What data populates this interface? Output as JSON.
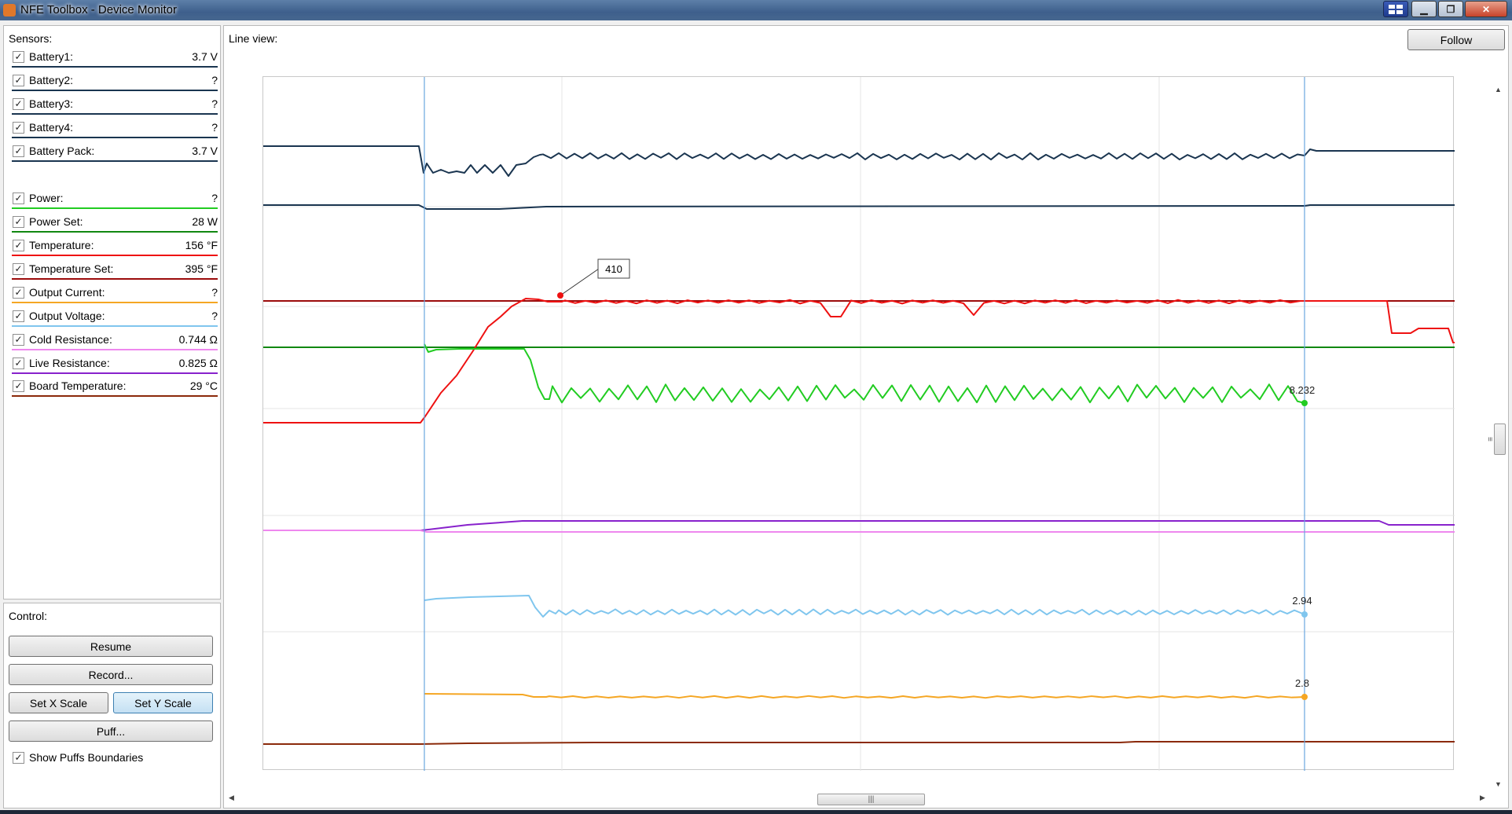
{
  "window": {
    "title": "NFE Toolbox - Device Monitor"
  },
  "sensors": {
    "header": "Sensors:",
    "items": [
      {
        "label": "Battery1:",
        "value": "3.7 V",
        "color": "#1a3550",
        "checked": "✓"
      },
      {
        "label": "Battery2:",
        "value": "?",
        "color": "#1a3550",
        "checked": "✓"
      },
      {
        "label": "Battery3:",
        "value": "?",
        "color": "#1a3550",
        "checked": "✓"
      },
      {
        "label": "Battery4:",
        "value": "?",
        "color": "#1a3550",
        "checked": "✓"
      },
      {
        "label": "Battery Pack:",
        "value": "3.7 V",
        "color": "#1a3550",
        "checked": "✓"
      },
      {
        "label": "Power:",
        "value": "?",
        "color": "#22cc22",
        "checked": "✓"
      },
      {
        "label": "Power Set:",
        "value": "28 W",
        "color": "#118811",
        "checked": "✓"
      },
      {
        "label": "Temperature:",
        "value": "156 °F",
        "color": "#ee1111",
        "checked": "✓"
      },
      {
        "label": "Temperature Set:",
        "value": "395 °F",
        "color": "#9b0b0b",
        "checked": "✓"
      },
      {
        "label": "Output Current:",
        "value": "?",
        "color": "#f5a623",
        "checked": "✓"
      },
      {
        "label": "Output Voltage:",
        "value": "?",
        "color": "#80c6ee",
        "checked": "✓"
      },
      {
        "label": "Cold Resistance:",
        "value": "0.744 Ω",
        "color": "#ee88ee",
        "checked": "✓"
      },
      {
        "label": "Live Resistance:",
        "value": "0.825 Ω",
        "color": "#8822cc",
        "checked": "✓"
      },
      {
        "label": "Board Temperature:",
        "value": "29 °C",
        "color": "#8b2a0a",
        "checked": "✓"
      }
    ]
  },
  "control": {
    "header": "Control:",
    "resume_label": "Resume",
    "record_label": "Record...",
    "set_x_scale_label": "Set X Scale",
    "set_y_scale_label": "Set Y Scale",
    "puff_label": "Puff...",
    "show_puffs_boundaries": {
      "label": "Show Puffs Boundaries",
      "checked": "✓"
    }
  },
  "line_view": {
    "header": "Line view:",
    "follow_label": "Follow",
    "scroll_grip": "|||",
    "icons": {
      "minimize": "minimize-icon",
      "maximize": "maximize-icon",
      "close": "close-icon",
      "scroll_left": "arrow-left-icon",
      "scroll_right": "arrow-right-icon",
      "scroll_up": "arrow-up-icon",
      "scroll_down": "arrow-down-icon",
      "app": "app-icon",
      "layout": "layout-icon"
    }
  },
  "chart_data": {
    "type": "line",
    "title": "",
    "xlabel": "",
    "ylabel": "",
    "grid": true,
    "x_range": [
      0,
      1516
    ],
    "markers_vertical": [
      205,
      1325
    ],
    "annotations": [
      {
        "text": "410",
        "series": "Temperature"
      },
      {
        "text": "8.232",
        "series": "Power"
      },
      {
        "text": "2.94",
        "series": "Output Voltage"
      },
      {
        "text": "2.8",
        "series": "Output Current"
      }
    ],
    "series": [
      {
        "name": "Battery1",
        "color": "#1a3550",
        "y_level": 88
      },
      {
        "name": "Battery Pack",
        "color": "#1a3550",
        "y_level": 163
      },
      {
        "name": "Temperature Set",
        "color": "#9b0b0b",
        "y_level": 285
      },
      {
        "name": "Power Set",
        "color": "#118811",
        "y_level": 344
      },
      {
        "name": "Temperature",
        "color": "#ee1111"
      },
      {
        "name": "Power",
        "color": "#22cc22"
      },
      {
        "name": "Live Resistance",
        "color": "#8822cc"
      },
      {
        "name": "Cold Resistance",
        "color": "#ee88ee",
        "y_level": 577
      },
      {
        "name": "Output Voltage",
        "color": "#80c6ee"
      },
      {
        "name": "Output Current",
        "color": "#f5a623"
      },
      {
        "name": "Board Temperature",
        "color": "#8b2a0a"
      }
    ]
  }
}
